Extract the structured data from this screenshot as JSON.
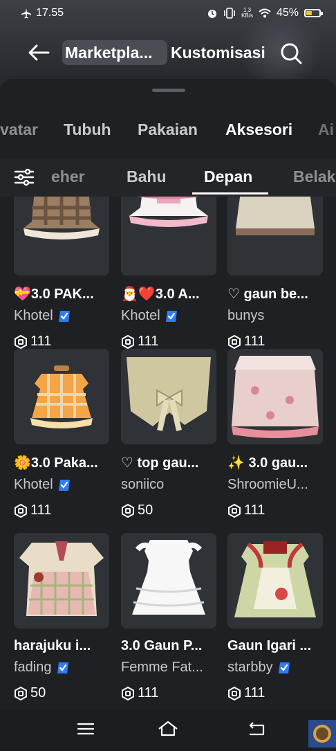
{
  "status": {
    "time": "17.55",
    "net_speed_value": "1,3",
    "net_speed_unit": "KB/s",
    "battery": "45%",
    "battery_level": 0.45,
    "airplane_icon": "airplane-icon",
    "alarm_icon": "alarm-icon",
    "vibrate_icon": "vibrate-icon",
    "wifi_icon": "wifi-icon"
  },
  "header": {
    "tabs": [
      "Marketpla...",
      "Kustomisasi"
    ],
    "active_tab": 0,
    "back_icon": "arrow-left-icon",
    "search_icon": "search-icon"
  },
  "categories": [
    "vatar",
    "Tubuh",
    "Pakaian",
    "Aksesori",
    "Ai"
  ],
  "active_category": "Aksesori",
  "subcategories": [
    "eher",
    "Bahu",
    "Depan",
    "Belak"
  ],
  "active_subcategory": "Depan",
  "items": [
    {
      "name": "💝3.0 PAK...",
      "creator": "Khotel",
      "verified": true,
      "price": "111",
      "thumb": "gingham-brown-dress"
    },
    {
      "name": "🎅❤️3.0 A...",
      "creator": "Khotel",
      "verified": true,
      "price": "111",
      "thumb": "pink-maid-dress"
    },
    {
      "name": "♡ gaun be...",
      "creator": "bunys",
      "verified": false,
      "price": "111",
      "thumb": "beige-dress"
    },
    {
      "name": "🌼3.0 Paka...",
      "creator": "Khotel",
      "verified": true,
      "price": "111",
      "thumb": "orange-gingham-dress"
    },
    {
      "name": "♡ top gau...",
      "creator": "soniico",
      "verified": false,
      "price": "50",
      "thumb": "beige-bow-top"
    },
    {
      "name": "✨ 3.0 gau...",
      "creator": "ShroomieU...",
      "verified": false,
      "price": "111",
      "thumb": "pink-floral-skirt"
    },
    {
      "name": "harajuku i...",
      "creator": "fading",
      "verified": true,
      "price": "50",
      "thumb": "harajuku-top"
    },
    {
      "name": "3.0 Gaun P...",
      "creator": "Femme Fat...",
      "verified": false,
      "price": "111",
      "thumb": "white-ruffle-dress"
    },
    {
      "name": "Gaun Igari ...",
      "creator": "starbby",
      "verified": true,
      "price": "111",
      "thumb": "green-red-dress"
    }
  ],
  "navbar": {
    "menu_icon": "menu-icon",
    "home_icon": "home-icon",
    "back_icon": "back-nav-icon"
  },
  "colors": {
    "accent_verified": "#2f7df6",
    "battery": "#f2c230",
    "background": "#1e2024"
  }
}
